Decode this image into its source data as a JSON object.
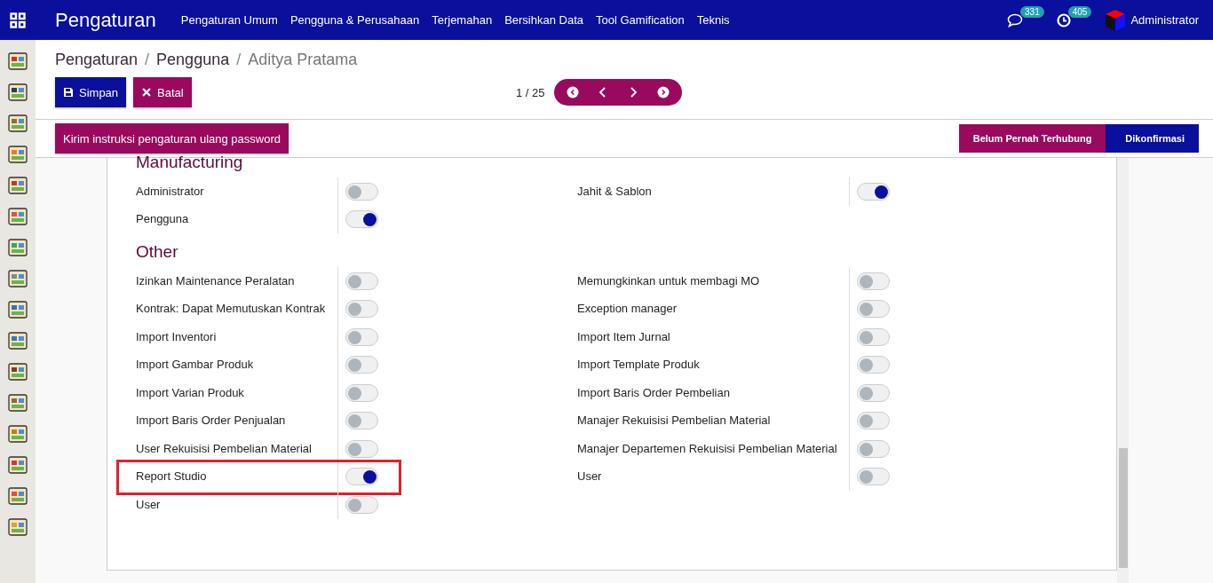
{
  "app_title": "Pengaturan",
  "menu": [
    "Pengaturan Umum",
    "Pengguna & Perusahaan",
    "Terjemahan",
    "Bersihkan Data",
    "Tool Gamification",
    "Teknis"
  ],
  "messages_count": "331",
  "activities_count": "405",
  "user_name": "Administrator",
  "breadcrumb": [
    {
      "label": "Pengaturan",
      "current": false
    },
    {
      "separator": "/",
      "label": "Pengguna",
      "current": false
    },
    {
      "separator": "/",
      "label": "Aditya Pratama",
      "current": true
    }
  ],
  "buttons": [
    {
      "label": "Simpan",
      "kind": "save"
    },
    {
      "label": "Batal",
      "kind": "discard"
    }
  ],
  "pager": {
    "value": "1 / 25"
  },
  "action_button": "Kirim instruksi pengaturan ulang password",
  "status_steps": [
    {
      "label": "Belum Pernah Terhubung",
      "selected": false
    },
    {
      "label": "Dikonfirmasi",
      "selected": true
    }
  ],
  "sections": [
    {
      "title": "Manufacturing",
      "left": [
        {
          "label": "Administrator",
          "on": false,
          "highlighted": false
        },
        {
          "label": "Pengguna",
          "on": true,
          "highlighted": false
        }
      ],
      "right": [
        {
          "label": "Jahit & Sablon",
          "on": true,
          "highlighted": false
        }
      ]
    },
    {
      "title": "Other",
      "left": [
        {
          "label": "Izinkan Maintenance Peralatan",
          "on": false,
          "highlighted": false
        },
        {
          "label": "Kontrak: Dapat Memutuskan Kontrak",
          "on": false,
          "highlighted": false
        },
        {
          "label": "Import Inventori",
          "on": false,
          "highlighted": false
        },
        {
          "label": "Import Gambar Produk",
          "on": false,
          "highlighted": false
        },
        {
          "label": "Import Varian Produk",
          "on": false,
          "highlighted": false
        },
        {
          "label": "Import Baris Order Penjualan",
          "on": false,
          "highlighted": false
        },
        {
          "label": "User Rekuisisi Pembelian Material",
          "on": false,
          "highlighted": false
        },
        {
          "label": "Report Studio",
          "on": true,
          "highlighted": true
        },
        {
          "label": "User",
          "on": false,
          "highlighted": false
        }
      ],
      "right": [
        {
          "label": "Memungkinkan untuk membagi MO",
          "on": false,
          "highlighted": false
        },
        {
          "label": "Exception manager",
          "on": false,
          "highlighted": false
        },
        {
          "label": "Import Item Jurnal",
          "on": false,
          "highlighted": false
        },
        {
          "label": "Import Template Produk",
          "on": false,
          "highlighted": false
        },
        {
          "label": "Import Baris Order Pembelian",
          "on": false,
          "highlighted": false
        },
        {
          "label": "Manajer Rekuisisi Pembelian Material",
          "on": false,
          "highlighted": false
        },
        {
          "label": "Manajer Departemen Rekuisisi Pembelian Material",
          "on": false,
          "highlighted": false
        },
        {
          "label": "User",
          "on": false,
          "highlighted": false
        }
      ]
    }
  ]
}
